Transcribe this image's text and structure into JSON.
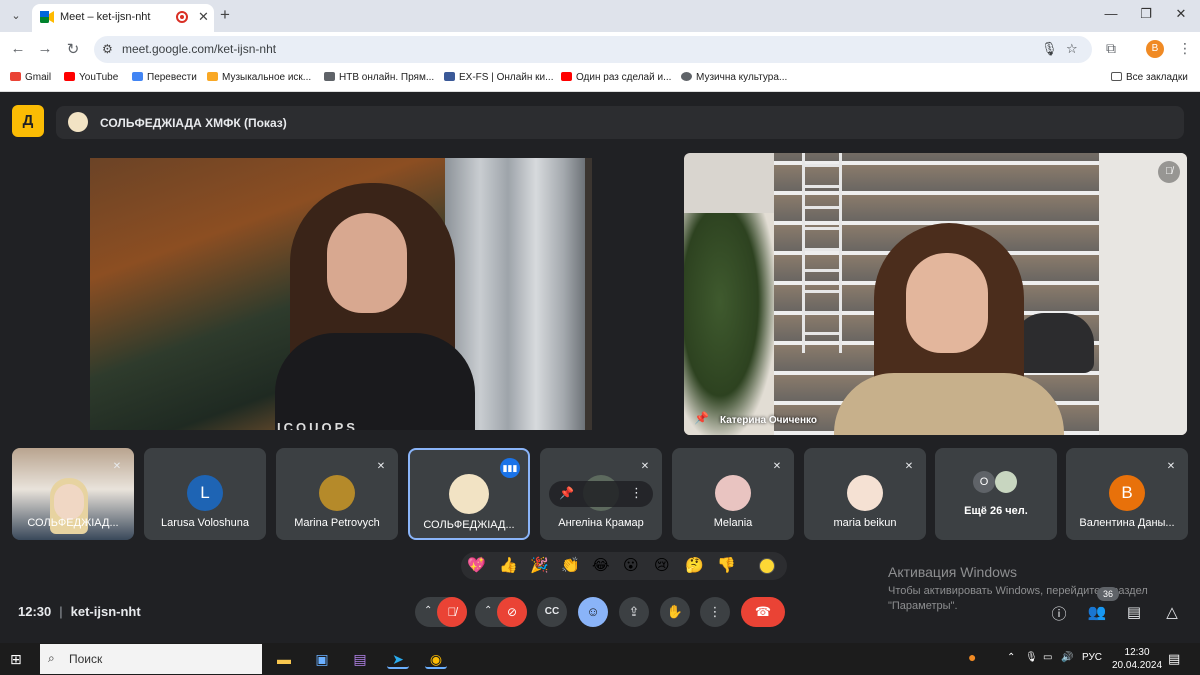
{
  "browser": {
    "tab": {
      "title": "Meet – ket-ijsn-nht"
    },
    "url": "meet.google.com/ket-ijsn-nht",
    "profile_initial": "B",
    "bookmarks": [
      {
        "label": "Gmail",
        "color": "#ea4335"
      },
      {
        "label": "YouTube",
        "color": "#ff0000"
      },
      {
        "label": "Перевести",
        "color": "#4285f4"
      },
      {
        "label": "Музыкальное иск...",
        "color": "#f9a825"
      },
      {
        "label": "НТВ онлайн. Прям...",
        "color": "#5f6368"
      },
      {
        "label": "EX-FS | Онлайн ки...",
        "color": "#3b5998"
      },
      {
        "label": "Один раз сделай и...",
        "color": "#ff0000"
      },
      {
        "label": "Музична культура...",
        "color": "#5f6368"
      }
    ],
    "all_bookmarks": "Все закладки"
  },
  "meet": {
    "logo_glyph": "Д",
    "presentation_title": "СОЛЬФЕДЖІАДА ХМФК (Показ)",
    "main_shirt_text": "ICOUOPS",
    "spotlight_name": "Катерина Очиченко",
    "participants": [
      {
        "name": "СОЛЬФЕДЖІАД...",
        "type": "camera",
        "muted": true
      },
      {
        "name": "Larusa Voloshuna",
        "type": "initial",
        "initial": "L",
        "color": "#1e64b4",
        "muted": false
      },
      {
        "name": "Marina Petrovych",
        "type": "image",
        "color": "#b58a2a",
        "muted": true
      },
      {
        "name": "СОЛЬФЕДЖІАД...",
        "type": "image",
        "color": "#f2e3c4",
        "speaking": true,
        "active": true
      },
      {
        "name": "Ангеліна Крамар",
        "type": "image",
        "color": "#5d6a5e",
        "muted": true,
        "hover": true
      },
      {
        "name": "Melania",
        "type": "image",
        "color": "#e9c4c1",
        "muted": true
      },
      {
        "name": "maria beikun",
        "type": "image",
        "color": "#f5e1d3",
        "muted": true
      },
      {
        "name": "Ещё 26 чел.",
        "type": "more",
        "count_initial": "O"
      },
      {
        "name": "Валентина Даны...",
        "type": "initial",
        "initial": "B",
        "color": "#e8710a",
        "muted": true
      }
    ],
    "reactions": [
      "💖",
      "👍",
      "🎉",
      "👏",
      "😂",
      "😮",
      "😢",
      "🤔",
      "👎"
    ],
    "watermark": {
      "title": "Активация Windows",
      "line1": "Чтобы активировать Windows, перейдите в раздел",
      "line2": "\"Параметры\"."
    },
    "time": "12:30",
    "meeting_code": "ket-ijsn-nht",
    "people_count": "36"
  },
  "taskbar": {
    "search_text": "Поиск",
    "lang": "РУС",
    "time": "12:30",
    "date": "20.04.2024"
  },
  "colors": {
    "meet_bg": "#202124",
    "tile_bg": "#3c4043",
    "danger": "#ea4335",
    "accent": "#8ab4f8"
  }
}
